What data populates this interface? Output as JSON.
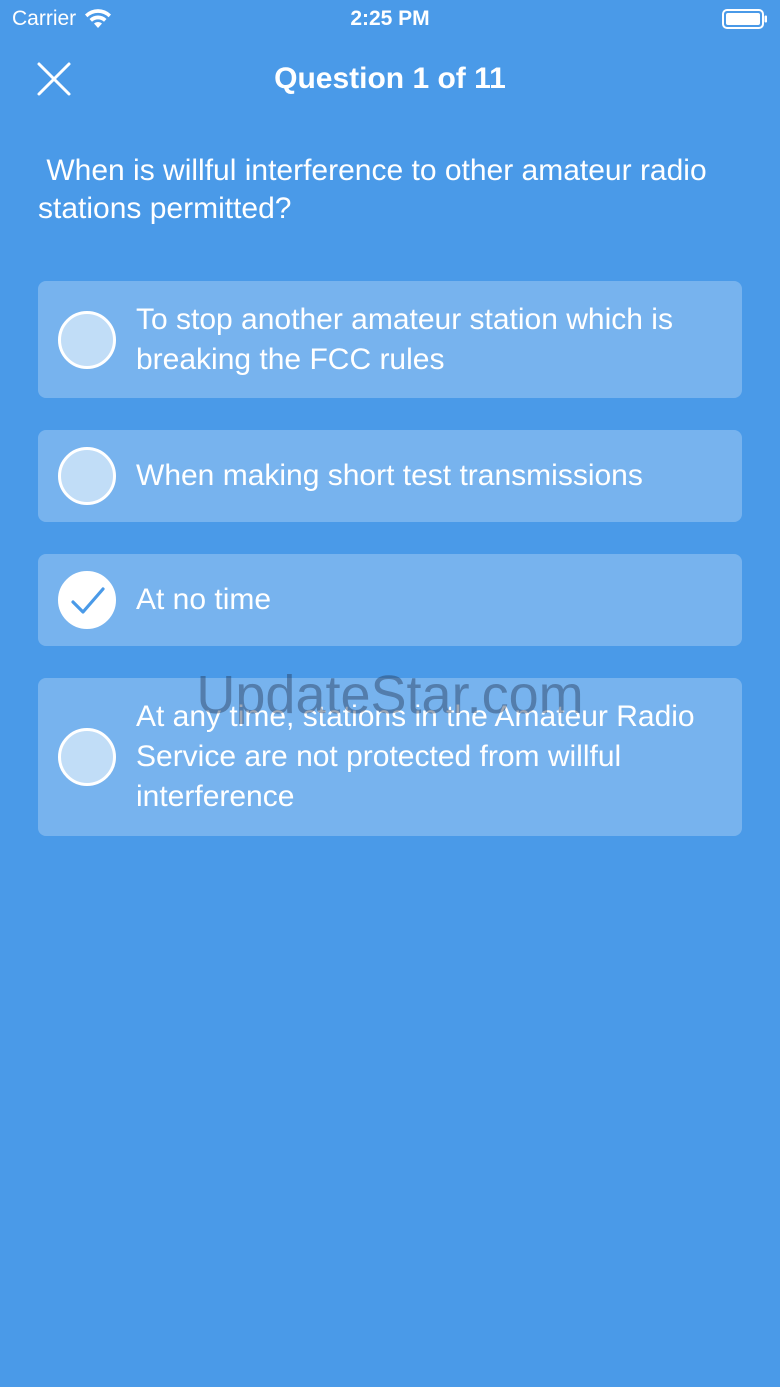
{
  "status_bar": {
    "carrier": "Carrier",
    "time": "2:25 PM"
  },
  "nav": {
    "title": "Question 1 of 11",
    "close_icon": "close-icon"
  },
  "question": {
    "text": " When is willful interference to other amateur radio stations permitted?"
  },
  "answers": [
    {
      "label": "To stop another amateur station which is breaking the FCC rules",
      "selected": false
    },
    {
      "label": "When making short test transmissions",
      "selected": false
    },
    {
      "label": "At no time",
      "selected": true
    },
    {
      "label": "At any time, stations in the Amateur Radio Service are not protected from willful interference",
      "selected": false
    }
  ],
  "watermark": "UpdateStar.com",
  "colors": {
    "background": "#4a9ae8",
    "text": "#ffffff",
    "card": "rgba(255,255,255,0.25)"
  }
}
